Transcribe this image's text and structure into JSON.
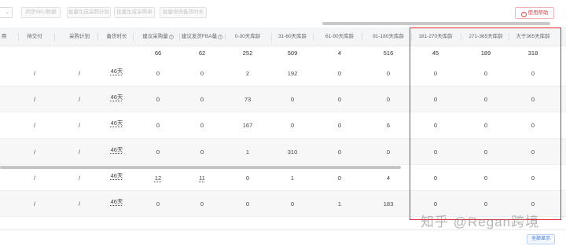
{
  "toolbar": {
    "buttons": [
      "同步SKU数据",
      "批量生成采购计划",
      "批量生成采购单",
      "批量修改备货时长"
    ],
    "help_label": "使用帮助"
  },
  "table": {
    "columns": [
      "用",
      "待交付",
      "采购计划",
      "备货时长",
      "建议采购量",
      "建议发货FBA量",
      "0-30天库龄",
      "31-60天库龄",
      "61-90天库龄",
      "91-180天库龄",
      "181-270天库龄",
      "271-365天库龄",
      "大于365天库龄"
    ],
    "totals": [
      "",
      "",
      "",
      "",
      "66",
      "62",
      "252",
      "509",
      "4",
      "516",
      "45",
      "189",
      "318"
    ],
    "rows": [
      [
        "",
        "/",
        "/",
        "46天",
        "0",
        "0",
        "2",
        "192",
        "0",
        "0",
        "0",
        "0",
        "0"
      ],
      [
        "",
        "/",
        "/",
        "46天",
        "0",
        "0",
        "73",
        "0",
        "0",
        "0",
        "0",
        "0",
        "0"
      ],
      [
        "",
        "/",
        "/",
        "46天",
        "0",
        "0",
        "167",
        "0",
        "0",
        "6",
        "0",
        "0",
        "0"
      ],
      [
        "",
        "/",
        "/",
        "46天",
        "0",
        "0",
        "1",
        "310",
        "0",
        "0",
        "0",
        "0",
        "0"
      ],
      [
        "",
        "/",
        "/",
        "46天",
        "12",
        "11",
        "0",
        "1",
        "0",
        "4",
        "0",
        "0",
        "0"
      ],
      [
        "",
        "/",
        "/",
        "46天",
        "0",
        "0",
        "0",
        "0",
        "1",
        "183",
        "0",
        "0",
        "0"
      ]
    ]
  },
  "footer": {
    "show_all_label": "全部显示"
  },
  "watermark": "知乎 @Regan跨境",
  "colors": {
    "highlight": "#e0282f",
    "help": "#e5484d",
    "accent": "#3a6fd8"
  }
}
